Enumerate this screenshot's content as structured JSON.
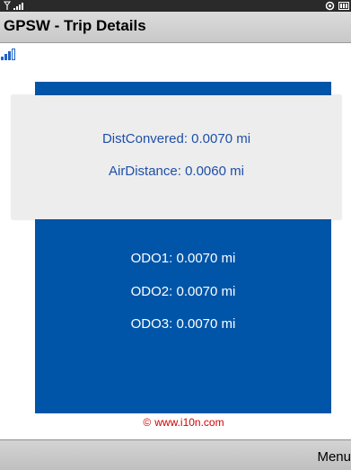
{
  "window": {
    "title": "GPSW - Trip Details"
  },
  "status_bar": {
    "signal_label": "T.ull",
    "icons": [
      "signal-icon",
      "settings-icon",
      "battery-icon"
    ]
  },
  "trip": {
    "dist_converted": "DistConvered: 0.0070 mi",
    "air_distance": "AirDistance: 0.0060 mi",
    "odo1": "ODO1: 0.0070 mi",
    "odo2": "ODO2: 0.0070 mi",
    "odo3": "ODO3: 0.0070 mi"
  },
  "credit": {
    "text": "www.i10n.com"
  },
  "softkeys": {
    "menu_label": "Menu"
  },
  "colors": {
    "panel_blue": "#0055a8",
    "card_grey": "#ededed",
    "credit_red": "#d40000",
    "status_bar": "#2a2a2a"
  }
}
